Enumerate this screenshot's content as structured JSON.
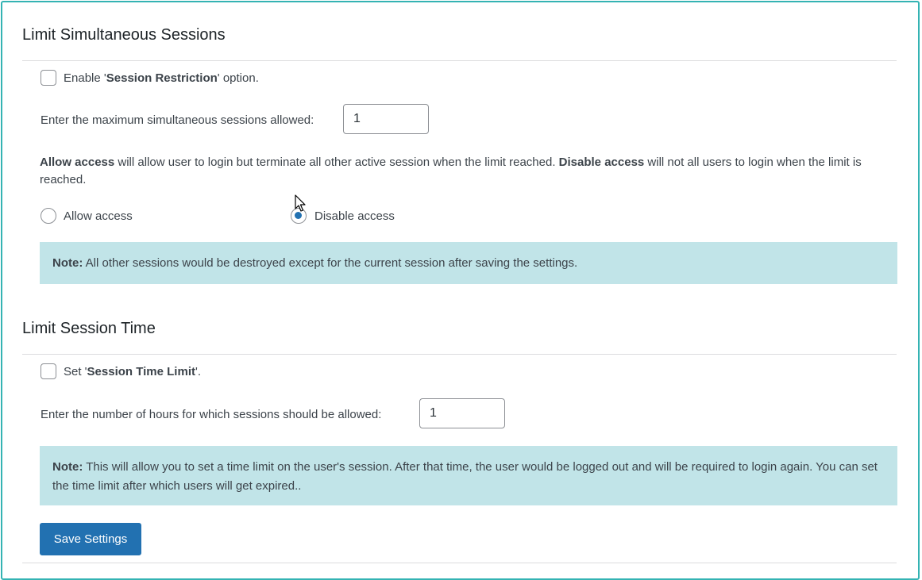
{
  "section1": {
    "title": "Limit Simultaneous Sessions",
    "enable_prefix": "Enable '",
    "enable_bold": "Session Restriction",
    "enable_suffix": "' option.",
    "max_sessions_label": "Enter the maximum simultaneous sessions allowed:",
    "max_sessions_value": "1",
    "desc_bold1": "Allow access",
    "desc_text1": " will allow user to login but terminate all other active session when the limit reached. ",
    "desc_bold2": "Disable access",
    "desc_text2": " will not all users to login when the limit is reached.",
    "radio_allow_label": "Allow access",
    "radio_disable_label": "Disable access",
    "selected_option": "Disable access",
    "note_bold": "Note:",
    "note_text": " All other sessions would be destroyed except for the current session after saving the settings."
  },
  "section2": {
    "title": "Limit Session Time",
    "set_prefix": "Set '",
    "set_bold": "Session Time Limit",
    "set_suffix": "'.",
    "hours_label": "Enter the number of hours for which sessions should be allowed:",
    "hours_value": "1",
    "note_bold": "Note:",
    "note_text": " This will allow you to set a time limit on the user's session. After that time, the user would be logged out and will be required to login again. You can set the time limit after which users will get expired.."
  },
  "save_button_label": "Save Settings",
  "colors": {
    "accent": "#2271b1",
    "frame_border": "#34b3b3",
    "note_background": "#c1e4e8"
  }
}
